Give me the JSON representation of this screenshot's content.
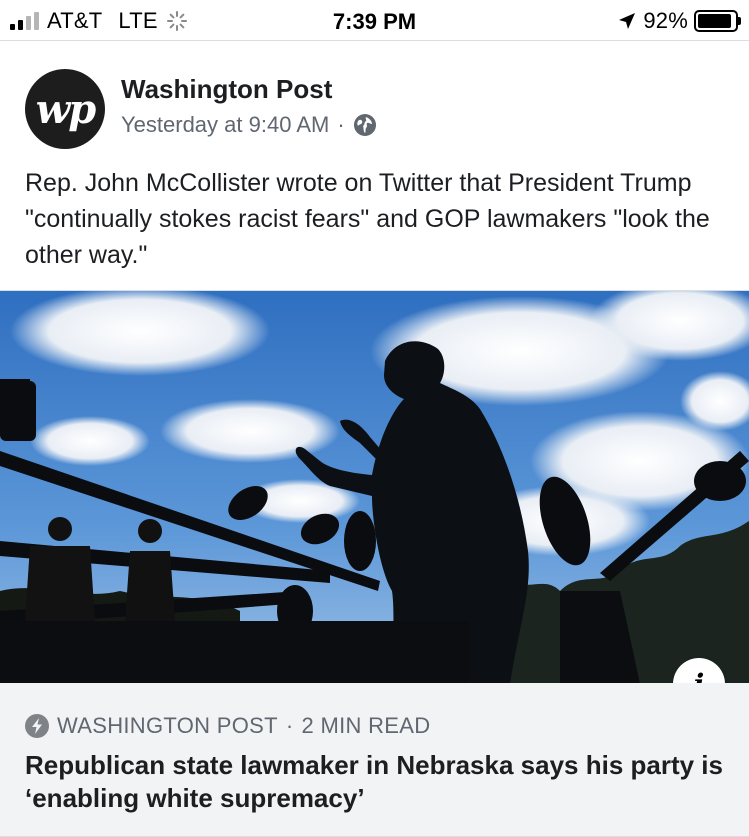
{
  "status_bar": {
    "carrier": "AT&T",
    "network": "LTE",
    "time": "7:39 PM",
    "battery_percent": "92%",
    "battery_level": 0.92,
    "signal_bars_filled": 2,
    "signal_bars_total": 4
  },
  "post": {
    "page_name": "Washington Post",
    "avatar_text": "wp",
    "timestamp": "Yesterday at 9:40 AM",
    "separator": "·",
    "audience_icon": "globe-icon",
    "text": "Rep. John McCollister wrote on Twitter that President Trump \"continually stokes racist fears\" and GOP lawmakers \"look the other way.\""
  },
  "link_preview": {
    "info_label": "i",
    "source": "WASHINGTON POST",
    "separator": "·",
    "read_time": "2 MIN READ",
    "source_icon": "instant-article-bolt-icon",
    "headline": "Republican state lawmaker in Nebraska says his party is ‘enabling white supremacy’"
  },
  "colors": {
    "sky": "#3f7fcc",
    "footer_bg": "#f2f3f5",
    "secondary_text": "#606770"
  }
}
